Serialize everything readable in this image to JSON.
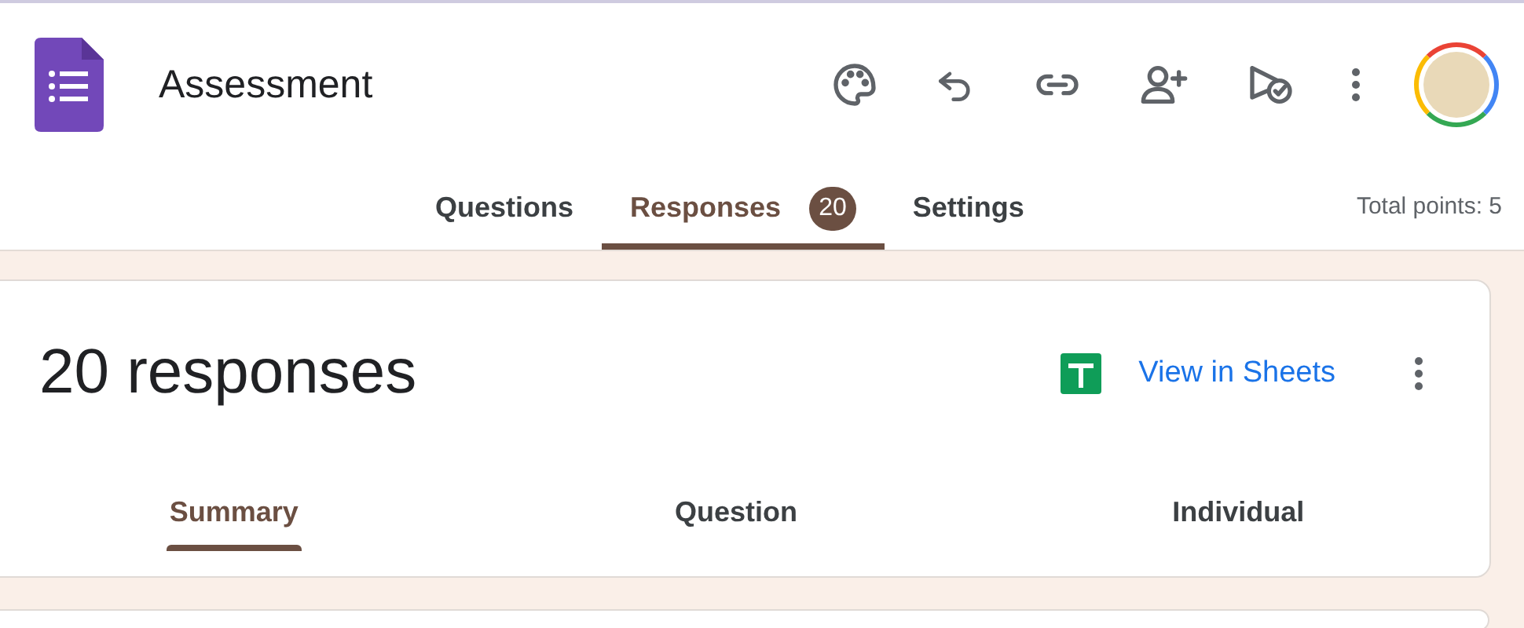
{
  "form": {
    "title": "Assessment"
  },
  "tabs": [
    {
      "label": "Questions",
      "selected": false
    },
    {
      "label": "Responses",
      "selected": true,
      "badge": "20"
    },
    {
      "label": "Settings",
      "selected": false
    }
  ],
  "total_points": "Total points: 5",
  "responses_card": {
    "heading": "20 responses",
    "link": "View in Sheets",
    "tabs": [
      {
        "label": "Summary",
        "selected": true
      },
      {
        "label": "Question",
        "selected": false
      },
      {
        "label": "Individual",
        "selected": false
      }
    ]
  }
}
